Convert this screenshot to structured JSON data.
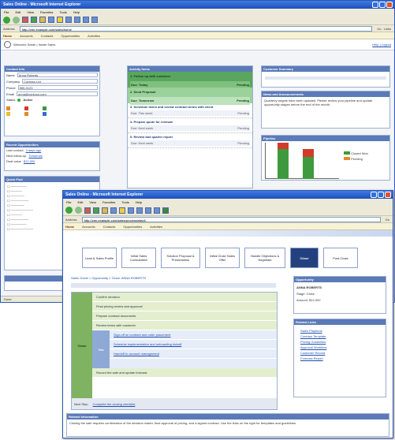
{
  "window1": {
    "title": "Sales Online - Microsoft Internet Explorer",
    "menu": [
      "File",
      "Edit",
      "View",
      "Favorites",
      "Tools",
      "Help"
    ],
    "address": "http://crm.example.com/sales/home",
    "go": "Go",
    "links": "Links",
    "nav": [
      "Home",
      "Accounts",
      "Contacts",
      "Opportunities",
      "Activities"
    ],
    "subbar_left": "Welcome Sarah | Inside Sales",
    "subbar_right": "Help | Logout",
    "contact_panel": {
      "header": "Contact Info",
      "rows": [
        {
          "l": "Name",
          "v": "Anna Roberts"
        },
        {
          "l": "Company",
          "v": "Contoso Ltd"
        },
        {
          "l": "Phone",
          "v": "555-0123"
        },
        {
          "l": "Email",
          "v": "anna@contoso.com"
        }
      ],
      "status_label": "Status",
      "status": "Active"
    },
    "details_panel": {
      "header": "Recent Opportunities",
      "rows": [
        {
          "l": "Last contact",
          "v": "3 days ago"
        },
        {
          "l": "Next follow-up",
          "v": "Tomorrow"
        },
        {
          "l": "Deal value",
          "v": "$12,000"
        }
      ]
    },
    "quick_panel": {
      "header": "Quick Find"
    },
    "tasks_header": "Activity Items",
    "tasks": [
      {
        "title": "1. Follow up with customer",
        "date": "Due: Today",
        "state": "Pending"
      },
      {
        "title": "2. Send Proposal",
        "date": "Due: Tomorrow",
        "state": "Pending"
      },
      {
        "title": "3. Schedule demo and review contract terms with client",
        "date": "Due: This week",
        "state": "Pending"
      },
      {
        "title": "4. Prepare quote for renewal",
        "date": "Due: Next week",
        "state": "Pending"
      },
      {
        "title": "5. Review last quarter report",
        "date": "Due: Next week",
        "state": "Pending"
      }
    ],
    "right_top": "Customer Summary",
    "news_header": "News and Announcements",
    "news_text": "Quarterly targets have been updated. Please review your pipeline and update opportunity stages before the end of the month.",
    "chart_header": "Pipeline",
    "legend": [
      "Closed Won",
      "Pending"
    ],
    "footer": "Done"
  },
  "window2": {
    "title": "Sales Online - Microsoft Internet Explorer",
    "menu": [
      "File",
      "Edit",
      "View",
      "Favorites",
      "Tools",
      "Help"
    ],
    "address": "http://crm.example.com/sales/process/step6",
    "nav_tabs": [
      "Lead & Sales Profile",
      "Initial Sales Consultation",
      "Solution Proposal & Presentation",
      "Initial Close Sales Offer",
      "Handle Objections & Negotiate",
      "Close",
      "Post-Close"
    ],
    "selected_tab": 5,
    "breadcrumb": "Sales Guide > Opportunity > Close: ANNA ROBERTS",
    "steps": [
      "Confirm decision",
      "Final pricing review and approval",
      "Prepare contract documents",
      "Review terms with customer",
      "Sign-off on contract and order placement",
      "Schedule implementation and onboarding kickoff",
      "Handoff to account management",
      "Record the sale and update forecast"
    ],
    "close_label": "Close",
    "yes_label": "Yes",
    "next_label": "Next Step",
    "next_link": "Complete the closing checklist",
    "right_header1": "Opportunity",
    "right_lines": [
      "ANNA ROBERTS",
      "Stage: Close",
      "Amount: $12,000"
    ],
    "right_header2": "Related Links",
    "right_links": [
      "Sales Playbook",
      "Contract Template",
      "Pricing Guidelines",
      "Approval Workflow",
      "Customer Record",
      "Forecast Report"
    ],
    "bottom_header": "Related Information",
    "bottom_text": "Closing the sale requires confirmation of the decision maker, final approval of pricing, and a signed contract. Use the links on the right for templates and guidelines."
  }
}
